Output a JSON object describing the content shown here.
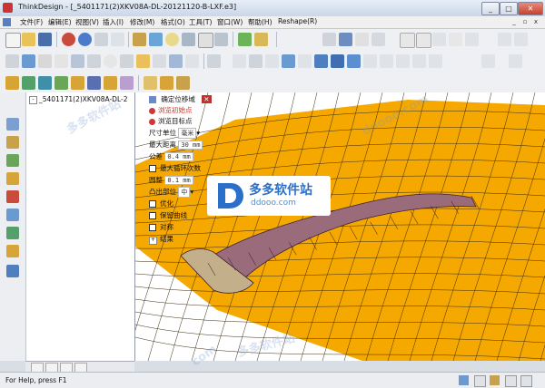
{
  "window": {
    "title": "ThinkDesign - [_5401171(2)XKV08A-DL-20121120-B-LXF.e3]",
    "minimize": "_",
    "maximize": "□",
    "close": "✕"
  },
  "menu": {
    "items": [
      "文件(F)",
      "编辑(E)",
      "视图(V)",
      "插入(I)",
      "修改(M)",
      "格式(O)",
      "工具(T)",
      "窗口(W)",
      "帮助(H)",
      "Reshape(R)"
    ],
    "mdi_min": "_",
    "mdi_restore": "▫",
    "mdi_close": "x"
  },
  "tree": {
    "root_label": "_5401171(2)XKV08A-DL-2",
    "expand_sign": "-"
  },
  "command_panel": {
    "header": "确定位移域",
    "close": "✕",
    "item1": "浏览初始点",
    "item2": "浏览目标点",
    "unit_label": "尺寸单位",
    "unit_value": "毫米",
    "max_dist_label": "最大距离",
    "max_dist_value": "30 mm",
    "tolerance_label": "公差",
    "tolerance_value": "0.4 mm",
    "max_iter_label": "最大循环次数",
    "fillet_label": "圆整",
    "fillet_value": "0.1 mm",
    "convex_label": "凸出部位",
    "convex_value": "中",
    "optimize_label": "优化",
    "keep_curves_label": "保留曲线",
    "symmetry_label": "对称",
    "results_label": "结果",
    "results_expand": "+"
  },
  "statusbar": {
    "text": "For Help, press F1"
  },
  "watermark": {
    "brand": "多多软件站",
    "domain": "ddooo.com",
    "text1": "多多软件站",
    "text2": "ddooo.com",
    "text3": "多多软件站",
    "text4": "com"
  },
  "colors": {
    "mesh": "#f5a800",
    "mesh_lines": "#3a2a10",
    "part": "#9a6b7a",
    "accent_red": "#d0353c",
    "logo_blue": "#2a6fc9"
  }
}
